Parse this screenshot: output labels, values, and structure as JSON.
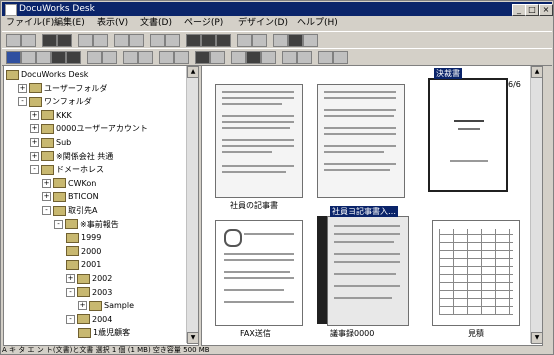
{
  "window": {
    "title": "DocuWorks Desk",
    "min_label": "_",
    "max_label": "□",
    "close_label": "×"
  },
  "menu": [
    {
      "name": "menu-file",
      "label": "ファイル(F)"
    },
    {
      "name": "menu-edit",
      "label": "編集(E)"
    },
    {
      "name": "menu-view",
      "label": "表示(V)"
    },
    {
      "name": "menu-document",
      "label": "文書(D)"
    },
    {
      "name": "menu-page",
      "label": "ページ(P)"
    },
    {
      "name": "menu-design",
      "label": "デザイン(D)"
    },
    {
      "name": "menu-help",
      "label": "ヘルプ(H)"
    }
  ],
  "tree": [
    {
      "label": "DocuWorks Desk",
      "level": 0,
      "exp": "",
      "name": "tree-root"
    },
    {
      "label": "ユーザーフォルダ",
      "level": 1,
      "exp": "+",
      "name": "tree-user-folder"
    },
    {
      "label": "ワンフォルダ",
      "level": 1,
      "exp": "-",
      "name": "tree-one-folder"
    },
    {
      "label": "KKK",
      "level": 2,
      "exp": "+",
      "name": "tree-kkk"
    },
    {
      "label": "0000ユーザーアカウント",
      "level": 2,
      "exp": "+",
      "name": "tree-user-account"
    },
    {
      "label": "Sub",
      "level": 2,
      "exp": "+",
      "name": "tree-sub"
    },
    {
      "label": "※関係会社 共通",
      "level": 2,
      "exp": "+",
      "name": "tree-affiliates"
    },
    {
      "label": "ドメーホレス",
      "level": 2,
      "exp": "-",
      "name": "tree-domain"
    },
    {
      "label": "CWKon",
      "level": 3,
      "exp": "+",
      "name": "tree-cwkon"
    },
    {
      "label": "BTICON",
      "level": 3,
      "exp": "+",
      "name": "tree-bticon"
    },
    {
      "label": "取引先A",
      "level": 3,
      "exp": "-",
      "name": "tree-client-a"
    },
    {
      "label": "※事前報告",
      "level": 4,
      "exp": "-",
      "name": "tree-report"
    },
    {
      "label": "1999",
      "level": 5,
      "exp": "",
      "name": "tree-1999"
    },
    {
      "label": "2000",
      "level": 5,
      "exp": "",
      "name": "tree-2000"
    },
    {
      "label": "2001",
      "level": 5,
      "exp": "",
      "name": "tree-2001"
    },
    {
      "label": "2002",
      "level": 5,
      "exp": "+",
      "name": "tree-2002"
    },
    {
      "label": "2003",
      "level": 5,
      "exp": "-",
      "name": "tree-2003"
    },
    {
      "label": "Sample",
      "level": 6,
      "exp": "+",
      "name": "tree-sample"
    },
    {
      "label": "2004",
      "level": 5,
      "exp": "-",
      "name": "tree-2004"
    },
    {
      "label": "1歳児顧客",
      "level": 6,
      "exp": "",
      "name": "tree-customer"
    }
  ],
  "docs": [
    {
      "name": "doc-fax",
      "caption": "社員の記事書",
      "selected": false
    },
    {
      "name": "doc-binder",
      "caption": "",
      "selected": false
    },
    {
      "name": "doc-cover",
      "caption": "",
      "selected": true
    },
    {
      "name": "doc-memo",
      "caption": "FAX送信",
      "selected": false
    },
    {
      "name": "doc-summary",
      "caption": "議事録0000",
      "selected": false
    },
    {
      "name": "doc-table",
      "caption": "見積",
      "selected": false
    }
  ],
  "content": {
    "stack_count": "6/6",
    "stamp_label": "決裁書",
    "selected_caption": "社員ヨ記事書入…"
  },
  "status": {
    "text": "A    キ タ エ ン ト(文書)と文書  選択 1 個 (1 MB)  空き容量 500 MB"
  }
}
